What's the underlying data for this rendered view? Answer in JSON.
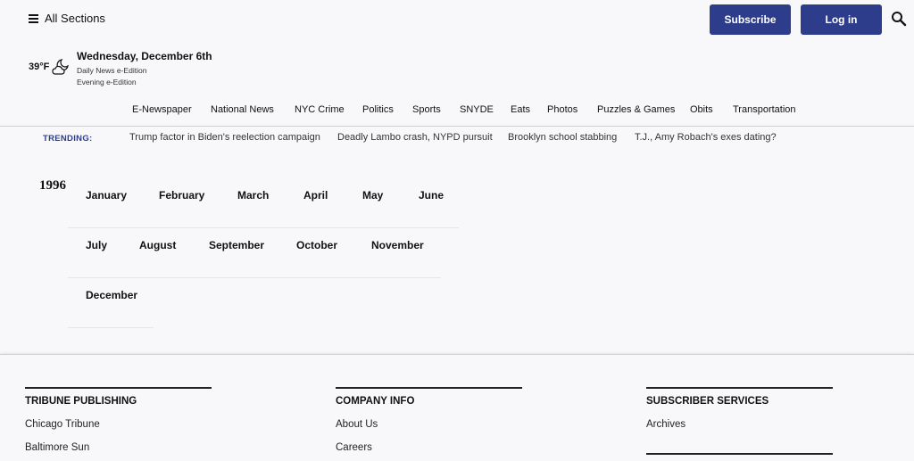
{
  "header": {
    "sections_label": "All Sections",
    "subscribe_label": "Subscribe",
    "login_label": "Log in",
    "search_icon": "search-icon",
    "weather": {
      "temp": "39°F",
      "icon": "partly-cloudy-night-icon"
    },
    "date": "Wednesday, December 6th",
    "edition_daily": "Daily News e-Edition",
    "edition_evening": "Evening e-Edition",
    "accent_color": "#2e3c8c"
  },
  "nav": {
    "items": [
      "E-Newspaper",
      "National News",
      "NYC Crime",
      "Politics",
      "Sports",
      "SNYDE",
      "Eats",
      "Photos",
      "Puzzles & Games",
      "Obits",
      "Transportation"
    ]
  },
  "trending": {
    "label": "TRENDING:",
    "items": [
      "Trump factor in Biden's reelection campaign",
      "Deadly Lambo crash, NYPD pursuit",
      "Brooklyn school stabbing",
      "T.J., Amy Robach's exes dating?"
    ]
  },
  "archive": {
    "year": "1996",
    "months": [
      "January",
      "February",
      "March",
      "April",
      "May",
      "June",
      "July",
      "August",
      "September",
      "October",
      "November",
      "December"
    ]
  },
  "footer": {
    "col1": {
      "title": "TRIBUNE PUBLISHING",
      "links": [
        "Chicago Tribune",
        "Baltimore Sun"
      ]
    },
    "col2": {
      "title": "COMPANY INFO",
      "links": [
        "About Us",
        "Careers"
      ]
    },
    "col3": {
      "title": "SUBSCRIBER SERVICES",
      "links": [
        "Archives"
      ]
    }
  }
}
